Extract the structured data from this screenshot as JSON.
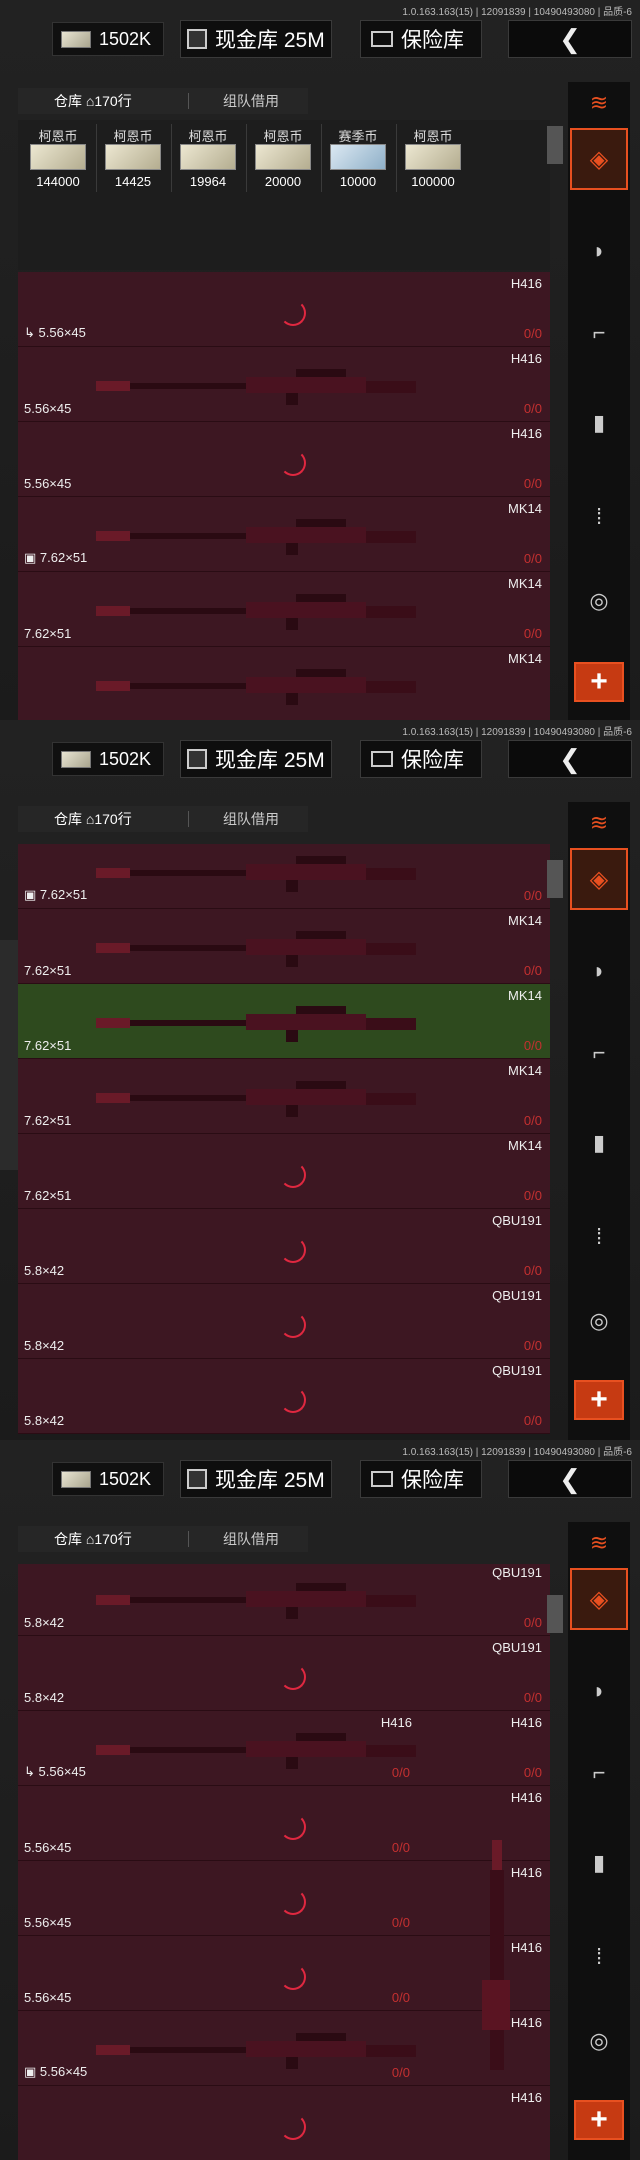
{
  "version": "1.0.163.163(15) | 12091839 | 10490493080 | 品质-6",
  "topbar": {
    "money": "1502K",
    "cash_vault": "现金库 25M",
    "safe": "保险库",
    "back": "❮"
  },
  "tabs": {
    "warehouse": "仓库",
    "rows": "170行",
    "team": "组队借用"
  },
  "currencies": [
    {
      "name": "柯恩币",
      "value": "144000"
    },
    {
      "name": "柯恩币",
      "value": "14425"
    },
    {
      "name": "柯恩币",
      "value": "19964"
    },
    {
      "name": "柯恩币",
      "value": "20000"
    },
    {
      "name": "赛季币",
      "value": "10000"
    },
    {
      "name": "柯恩币",
      "value": "100000"
    }
  ],
  "screen1": [
    {
      "name": "H416",
      "cal": "5.56×45",
      "dur": "0/0",
      "icon": "↳"
    },
    {
      "name": "H416",
      "cal": "5.56×45",
      "dur": "0/0"
    },
    {
      "name": "H416",
      "cal": "5.56×45",
      "dur": "0/0"
    },
    {
      "name": "MK14",
      "cal": "7.62×51",
      "dur": "0/0",
      "icon": "▣"
    },
    {
      "name": "MK14",
      "cal": "7.62×51",
      "dur": "0/0"
    },
    {
      "name": "MK14",
      "cal": "",
      "dur": ""
    }
  ],
  "screen2": [
    {
      "name": "",
      "cal": "7.62×51",
      "dur": "0/0",
      "icon": "▣"
    },
    {
      "name": "MK14",
      "cal": "7.62×51",
      "dur": "0/0"
    },
    {
      "name": "MK14",
      "cal": "7.62×51",
      "dur": "0/0"
    },
    {
      "name": "MK14",
      "cal": "7.62×51",
      "dur": "0/0"
    },
    {
      "name": "MK14",
      "cal": "7.62×51",
      "dur": "0/0"
    },
    {
      "name": "QBU191",
      "cal": "5.8×42",
      "dur": "0/0"
    },
    {
      "name": "QBU191",
      "cal": "5.8×42",
      "dur": "0/0"
    },
    {
      "name": "QBU191",
      "cal": "5.8×42",
      "dur": "0/0"
    }
  ],
  "screen3": [
    {
      "name": "QBU191",
      "cal": "5.8×42",
      "dur": "0/0"
    },
    {
      "name": "QBU191",
      "cal": "5.8×42",
      "dur": "0/0"
    },
    {
      "name": "H416",
      "name2": "H416",
      "cal": "5.56×45",
      "dur": "0/0",
      "dur2": "0/0",
      "icon": "↳"
    },
    {
      "name": "H416",
      "cal": "5.56×45",
      "dur2": "0/0"
    },
    {
      "name": "H416",
      "cal": "5.56×45",
      "dur2": "0/0"
    },
    {
      "name": "H416",
      "cal": "5.56×45",
      "dur2": "0/0"
    },
    {
      "name": "H416",
      "cal": "5.56×45",
      "dur2": "0/0",
      "icon": "▣"
    },
    {
      "name": "H416",
      "cal": "",
      "dur2": ""
    }
  ],
  "colors": {
    "row_bg": "#3d1722",
    "selected_row": "#2e4a1e",
    "accent": "#e85020",
    "durability": "#e33333"
  }
}
